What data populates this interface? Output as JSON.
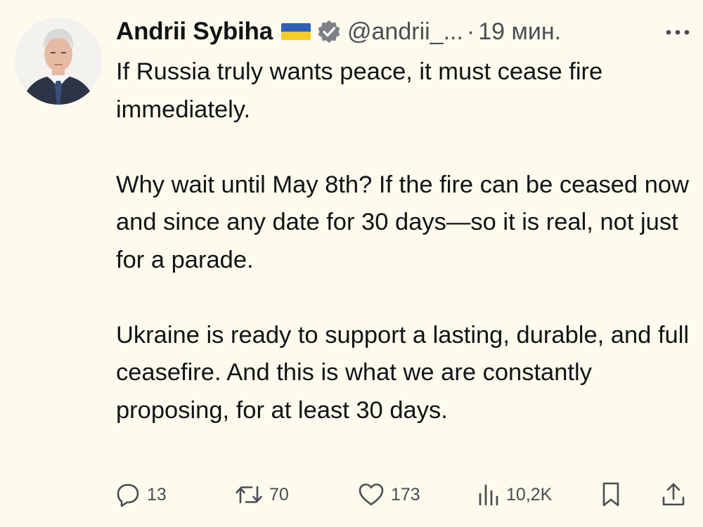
{
  "tweet": {
    "author": {
      "display_name": "Andrii Sybiha",
      "flag": "ukraine-flag",
      "verified_icon": "verified-badge-icon",
      "handle": "@andrii_...",
      "separator": "·",
      "timestamp": "19 мин."
    },
    "body": {
      "paragraph_1": "If Russia truly wants peace, it must cease fire immediately.",
      "paragraph_2": "Why wait until May 8th? If the fire can be ceased now and since any date for 30 days—so it is real, not just for a parade.",
      "paragraph_3": "Ukraine is ready to support a lasting, durable, and full ceasefire. And this is what we are constantly proposing, for at least 30 days."
    },
    "actions": {
      "replies": "13",
      "reposts": "70",
      "likes": "173",
      "views": "10,2K",
      "icons": [
        "reply-icon",
        "repost-icon",
        "like-icon",
        "views-icon",
        "bookmark-icon",
        "share-icon"
      ]
    }
  },
  "colors": {
    "background": "#fdfaee",
    "text": "#121314",
    "secondary_text": "#4a4e52",
    "verified_badge": "#7b8186",
    "flag_blue": "#2f5fb5",
    "flag_yellow": "#f5cc2a"
  }
}
